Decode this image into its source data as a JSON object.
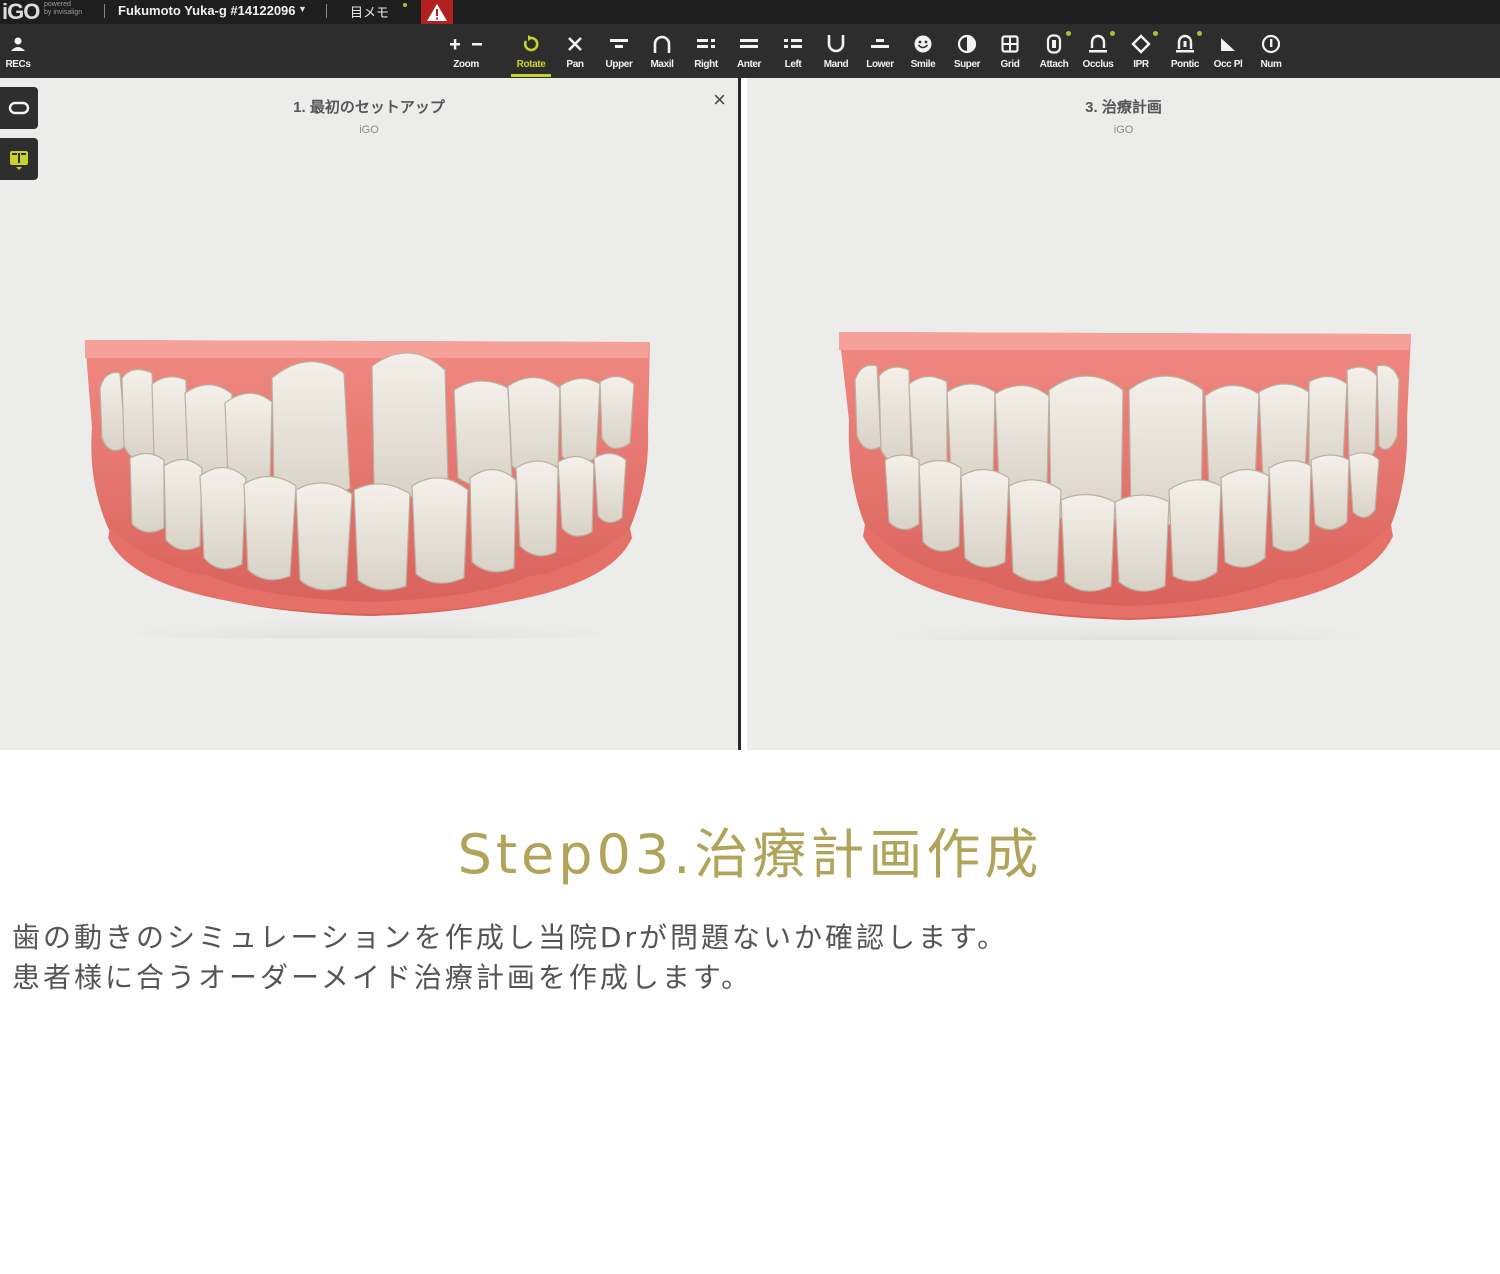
{
  "titlebar": {
    "logo": "iGO",
    "powered_line1": "powered",
    "powered_line2": "by invisalign",
    "patient": "Fukumoto Yuka-g #14122096",
    "memo": "目メモ"
  },
  "toolbar": {
    "recs_label": "RECs",
    "tools": [
      {
        "name": "zoom",
        "label": "Zoom"
      },
      {
        "name": "rotate",
        "label": "Rotate",
        "active": true
      },
      {
        "name": "pan",
        "label": "Pan"
      },
      {
        "name": "upper",
        "label": "Upper"
      },
      {
        "name": "maxil",
        "label": "Maxil"
      },
      {
        "name": "right",
        "label": "Right"
      },
      {
        "name": "anter",
        "label": "Anter"
      },
      {
        "name": "left",
        "label": "Left"
      },
      {
        "name": "mand",
        "label": "Mand"
      },
      {
        "name": "lower",
        "label": "Lower"
      },
      {
        "name": "smile",
        "label": "Smile"
      },
      {
        "name": "super",
        "label": "Super"
      },
      {
        "name": "grid",
        "label": "Grid"
      },
      {
        "name": "attach",
        "label": "Attach"
      },
      {
        "name": "occlus",
        "label": "Occlus"
      },
      {
        "name": "ipr",
        "label": "IPR"
      },
      {
        "name": "pontic",
        "label": "Pontic"
      },
      {
        "name": "occ-pl",
        "label": "Occ Pl"
      },
      {
        "name": "num",
        "label": "Num"
      }
    ],
    "accent_color": "#c9d22b"
  },
  "viewports": {
    "left": {
      "title": "1. 最初のセットアップ",
      "subtitle": "iGO",
      "close": "×"
    },
    "right": {
      "title": "3. 治療計画",
      "subtitle": "iGO"
    }
  },
  "content": {
    "heading": "Step03.治療計画作成",
    "heading_color": "#b0a35a",
    "line1": "歯の動きのシミュレーションを作成し当院Drが問題ないか確認します。",
    "line2": "患者様に合うオーダーメイド治療計画を作成します。"
  }
}
